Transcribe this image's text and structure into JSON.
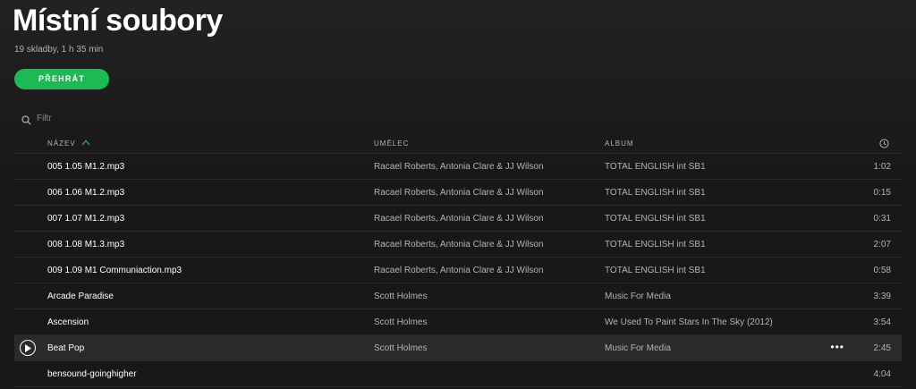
{
  "header": {
    "title": "Místní soubory",
    "subtitle": "19 skladby, 1 h 35 min",
    "play_label": "PŘEHRÁT"
  },
  "filter": {
    "placeholder": "Filtr",
    "icon": "search-icon"
  },
  "table": {
    "columns": {
      "title": "NÁZEV",
      "artist": "UMĚLEC",
      "album": "ALBUM",
      "duration_icon": "clock-icon"
    },
    "sort": {
      "column": "title",
      "direction": "ascending",
      "color": "#1db954"
    },
    "rows": [
      {
        "title": "005 1.05 M1.2.mp3",
        "artist": "Racael Roberts, Antonia Clare & JJ Wilson",
        "album": "TOTAL ENGLISH int SB1",
        "duration": "1:02"
      },
      {
        "title": "006 1.06 M1.2.mp3",
        "artist": "Racael Roberts, Antonia Clare & JJ Wilson",
        "album": "TOTAL ENGLISH int SB1",
        "duration": "0:15"
      },
      {
        "title": "007 1.07 M1.2.mp3",
        "artist": "Racael Roberts, Antonia Clare & JJ Wilson",
        "album": "TOTAL ENGLISH int SB1",
        "duration": "0:31"
      },
      {
        "title": "008 1.08 M1.3.mp3",
        "artist": "Racael Roberts, Antonia Clare & JJ Wilson",
        "album": "TOTAL ENGLISH int SB1",
        "duration": "2:07"
      },
      {
        "title": "009 1.09 M1 Communiaction.mp3",
        "artist": "Racael Roberts, Antonia Clare & JJ Wilson",
        "album": "TOTAL ENGLISH int SB1",
        "duration": "0:58"
      },
      {
        "title": "Arcade Paradise",
        "artist": "Scott Holmes",
        "album": "Music For Media",
        "duration": "3:39"
      },
      {
        "title": "Ascension",
        "artist": "Scott Holmes",
        "album": "We Used To Paint Stars In The Sky (2012)",
        "duration": "3:54"
      },
      {
        "title": "Beat Pop",
        "artist": "Scott Holmes",
        "album": "Music For Media",
        "duration": "2:45",
        "selected": true
      },
      {
        "title": "bensound-goinghigher",
        "artist": "",
        "album": "",
        "duration": "4:04"
      }
    ]
  },
  "colors": {
    "accent": "#1db954",
    "background": "#181818",
    "text_secondary": "#b3b3b3"
  }
}
